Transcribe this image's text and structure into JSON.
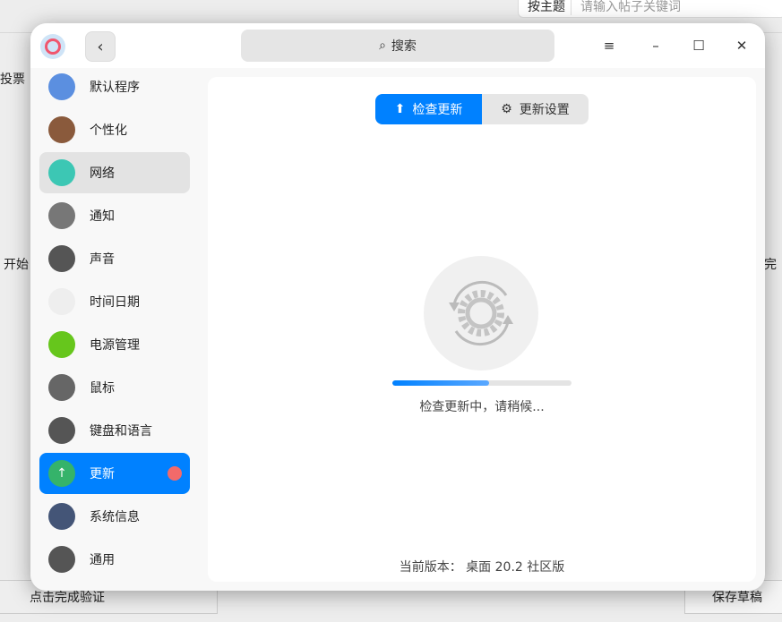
{
  "background": {
    "topic_select": "按主题",
    "keyword_placeholder": "请输入帖子关键词",
    "vote": "投票",
    "start": "开始",
    "done_partial": "完",
    "verify": "点击完成验证",
    "save_draft": "保存草稿"
  },
  "titlebar": {
    "search_placeholder": "搜索"
  },
  "sidebar": {
    "items": [
      {
        "label": "默认程序",
        "icon": "default-apps-icon",
        "color": "#5b8fe0"
      },
      {
        "label": "个性化",
        "icon": "palette-icon",
        "color": "#8a5a3c"
      },
      {
        "label": "网络",
        "icon": "network-icon",
        "color": "#3cc7b4"
      },
      {
        "label": "通知",
        "icon": "bell-icon",
        "color": "#777777"
      },
      {
        "label": "声音",
        "icon": "speaker-icon",
        "color": "#555555"
      },
      {
        "label": "时间日期",
        "icon": "clock-icon",
        "color": "#eeeeee"
      },
      {
        "label": "电源管理",
        "icon": "battery-icon",
        "color": "#66c61c"
      },
      {
        "label": "鼠标",
        "icon": "mouse-icon",
        "color": "#666666"
      },
      {
        "label": "键盘和语言",
        "icon": "keyboard-icon",
        "color": "#555555"
      },
      {
        "label": "更新",
        "icon": "update-icon",
        "color": "#35b36a"
      },
      {
        "label": "系统信息",
        "icon": "system-info-icon",
        "color": "#445577"
      },
      {
        "label": "通用",
        "icon": "general-icon",
        "color": "#555555"
      }
    ],
    "selected": "网络",
    "active": "更新"
  },
  "main": {
    "tabs": [
      {
        "label": "检查更新"
      },
      {
        "label": "更新设置"
      }
    ],
    "progress_percent": 54,
    "status": "检查更新中，请稍候...",
    "version": "当前版本：  桌面 20.2 社区版"
  },
  "accent": "#0081ff"
}
